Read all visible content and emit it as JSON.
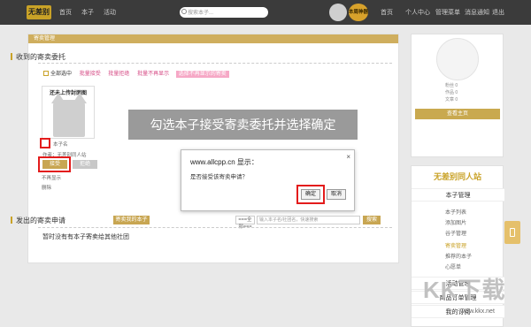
{
  "topbar": {
    "logo": "无差别",
    "nav": [
      "首页",
      "本子",
      "活动"
    ],
    "search_placeholder": "搜索本子...",
    "badge": "本周神器",
    "right_nav": [
      "首页",
      "个人中心",
      "管理菜单",
      "消息通知",
      "退出"
    ]
  },
  "main": {
    "header": "寄卖管理",
    "received_title": "收到的寄卖委托",
    "select_all": "全部选中",
    "bulk_actions": [
      "批量接受",
      "批量拒绝",
      "批量不再显示"
    ],
    "bulk_button": "选择不再显示的寄卖",
    "cover_label": "还未上传封面图",
    "book_name": "本子名",
    "author_line": "作者：无差别同人站",
    "accept": "接受",
    "reject": "拒绝",
    "no_show": "不再显示",
    "delete": "删除",
    "sent_title": "发出的寄卖申请",
    "sent_button": "寄卖我的本子",
    "filter_select": "===全部===",
    "filter_input_placeholder": "输入本子名/社团名，快速搜索",
    "filter_search": "搜索",
    "empty_text": "暂时没有有本子寄卖给其他社团"
  },
  "tip": "勾选本子接受寄卖委托并选择确定",
  "dialog": {
    "title": "www.allcpp.cn 显示：",
    "message": "是否接受该寄卖申请？",
    "ok": "确定",
    "cancel": "取消",
    "close": "×"
  },
  "right": {
    "stats": [
      "粉丝",
      "作品",
      "文章"
    ],
    "stat_values": [
      "0",
      "0",
      "0"
    ],
    "view_home": "查看主页",
    "brand": "无差别同人站",
    "menu_head": "本子管理",
    "menu_items": [
      "本子列表",
      "添加图片",
      "谷子管理",
      "寄卖管理",
      "推荐的本子",
      "心愿单"
    ],
    "menu_head2": "活动管理",
    "menu_head3": "商品订单管理",
    "menu_head4": "我的订阅"
  },
  "watermark": "KK下载",
  "watermark_url": "www.kkx.net",
  "colors": {
    "accent": "#c9a227",
    "pink": "#d64b85",
    "red_highlight": "#e31c1c"
  }
}
